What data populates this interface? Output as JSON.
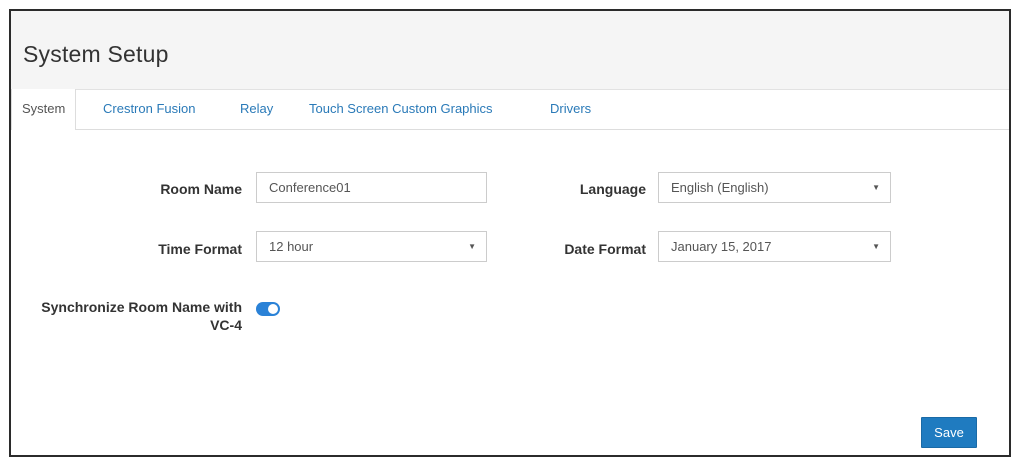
{
  "header": {
    "title": "System Setup"
  },
  "tabs": [
    {
      "label": "System",
      "active": true
    },
    {
      "label": "Crestron Fusion",
      "active": false
    },
    {
      "label": "Relay",
      "active": false
    },
    {
      "label": "Touch Screen Custom Graphics",
      "active": false
    },
    {
      "label": "Drivers",
      "active": false
    }
  ],
  "form": {
    "room_name": {
      "label": "Room Name",
      "value": "Conference01"
    },
    "language": {
      "label": "Language",
      "value": "English (English)"
    },
    "time_format": {
      "label": "Time Format",
      "value": "12 hour"
    },
    "date_format": {
      "label": "Date Format",
      "value": "January 15, 2017"
    },
    "sync_room_name": {
      "label_line1": "Synchronize Room Name with",
      "label_line2": "VC-4",
      "enabled": true
    }
  },
  "actions": {
    "save_label": "Save"
  },
  "colors": {
    "accent": "#1f7bc0",
    "link": "#2a7ab8",
    "toggle_on": "#2a82d7"
  },
  "icons": {
    "select_arrow": "caret-down-icon"
  }
}
